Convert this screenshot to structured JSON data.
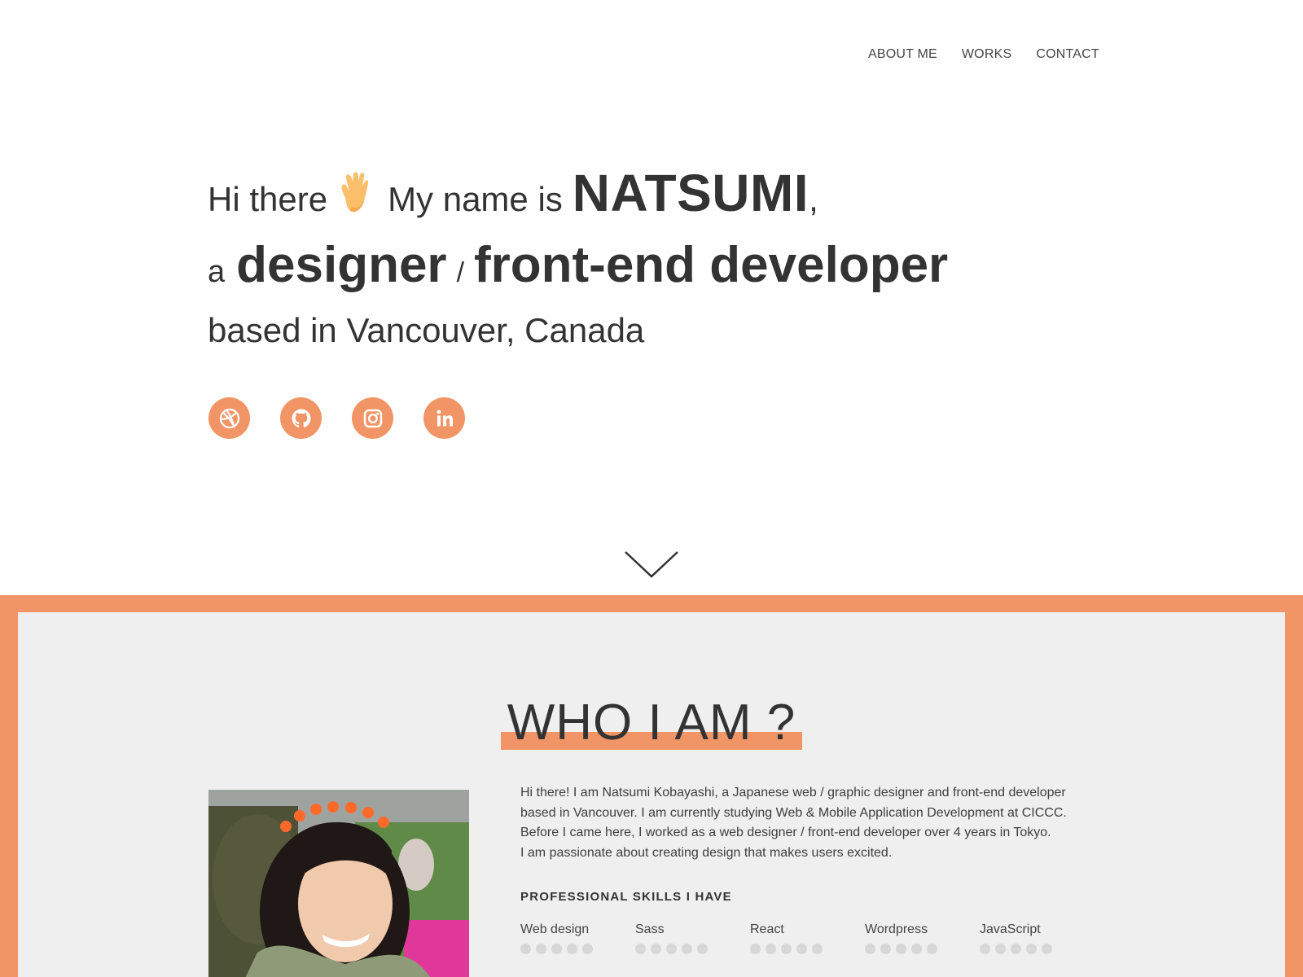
{
  "nav": {
    "items": [
      {
        "label": "ABOUT ME"
      },
      {
        "label": "WORKS"
      },
      {
        "label": "CONTACT"
      }
    ]
  },
  "hero": {
    "greeting": "Hi there",
    "intro": "My name is",
    "name": "NATSUMI",
    "comma": ",",
    "article": "a",
    "role1": "designer",
    "slash": "/",
    "role2": "front-end developer",
    "location": "based in Vancouver, Canada",
    "wave_icon": "waving-hand-icon"
  },
  "socials": [
    {
      "icon": "dribbble-icon"
    },
    {
      "icon": "github-icon"
    },
    {
      "icon": "instagram-icon"
    },
    {
      "icon": "linkedin-icon"
    }
  ],
  "scroll": {
    "icon": "chevron-down-icon"
  },
  "about": {
    "title": "WHO I AM ?",
    "bio_lines": [
      "Hi there! I am Natsumi Kobayashi, a Japanese web / graphic designer and front-end developer",
      "based in Vancouver. I am currently studying Web & Mobile Application Development at CICCC.",
      "Before I came here, I worked as a web designer / front-end developer over 4 years in Tokyo.",
      "I am passionate about creating design that makes users excited."
    ],
    "skills_title": "PROFESSIONAL SKILLS I HAVE",
    "skills": [
      {
        "name": "Web design",
        "level": 0
      },
      {
        "name": "Sass",
        "level": 0
      },
      {
        "name": "React",
        "level": 0
      },
      {
        "name": "Wordpress",
        "level": 0
      },
      {
        "name": "JavaScript",
        "level": 0
      }
    ]
  },
  "colors": {
    "accent": "#f29566",
    "text": "#333333",
    "section_bg": "#efefef",
    "dot_inactive": "#d7d7d7"
  }
}
